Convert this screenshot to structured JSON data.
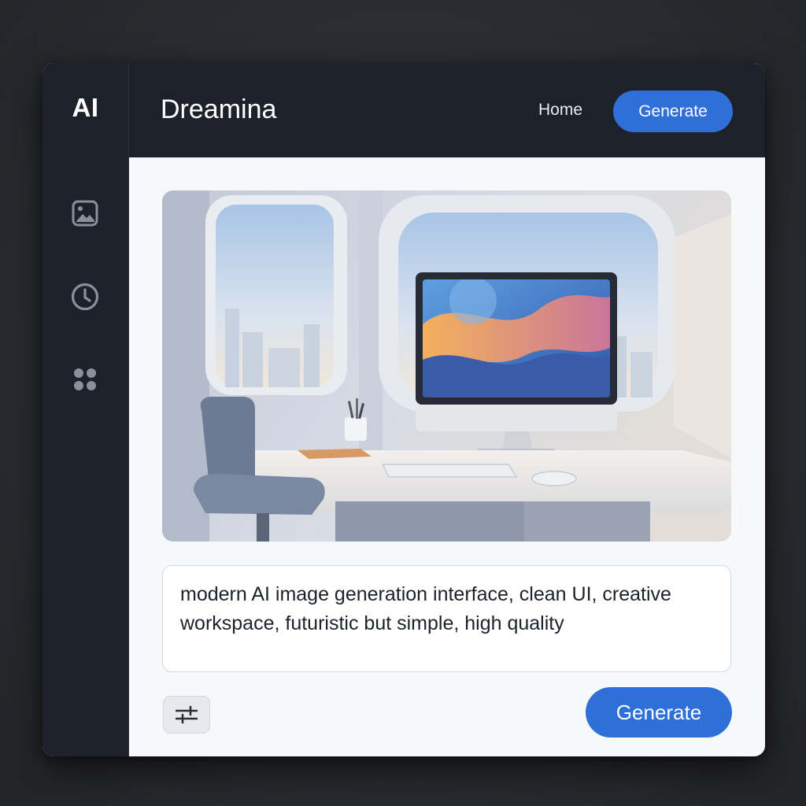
{
  "sidebar": {
    "brand": "AI",
    "items": [
      {
        "name": "image-icon"
      },
      {
        "name": "clock-icon"
      },
      {
        "name": "apps-grid-icon"
      }
    ]
  },
  "header": {
    "title": "Dreamina",
    "nav_home": "Home",
    "generate_label": "Generate"
  },
  "main": {
    "preview_image": "generated-image-workspace-desk",
    "prompt_value": "modern AI image generation interface, clean UI, creative workspace, futuristic but simple, high quality",
    "settings_icon": "sliders-icon",
    "generate_label": "Generate"
  },
  "colors": {
    "accent": "#2f6fd8",
    "sidebar_bg": "#1d2129",
    "content_bg": "#f7f8fa"
  }
}
